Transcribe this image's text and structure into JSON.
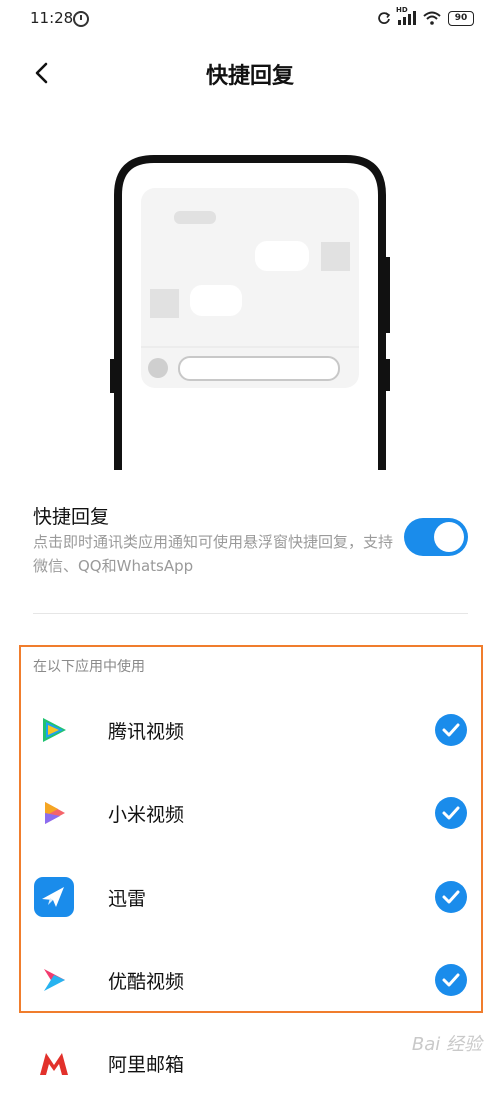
{
  "status_bar": {
    "time": "11:28",
    "network": "HD",
    "battery": "90"
  },
  "header": {
    "title": "快捷回复"
  },
  "feature": {
    "title": "快捷回复",
    "description": "点击即时通讯类应用通知可使用悬浮窗快捷回复，支持微信、QQ和WhatsApp",
    "enabled": true
  },
  "apps_section": {
    "label": "在以下应用中使用",
    "items": [
      {
        "name": "腾讯视频",
        "icon": "tencent-video-icon",
        "checked": true
      },
      {
        "name": "小米视频",
        "icon": "mi-video-icon",
        "checked": true
      },
      {
        "name": "迅雷",
        "icon": "xunlei-icon",
        "checked": true
      },
      {
        "name": "优酷视频",
        "icon": "youku-icon",
        "checked": true
      },
      {
        "name": "阿里邮箱",
        "icon": "ali-mail-icon"
      }
    ]
  },
  "watermark": "Bai 经验",
  "colors": {
    "accent": "#1a8ceb",
    "highlight_border": "#f07d2d"
  }
}
